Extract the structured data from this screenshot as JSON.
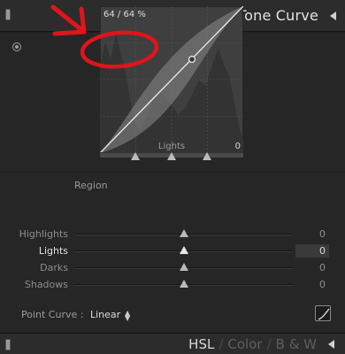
{
  "header": {
    "title": "Tone Curve"
  },
  "curve": {
    "readout": "64 / 64 %",
    "hover_region": "Lights",
    "edge_value": "0",
    "control_point": {
      "input_percent": 64,
      "output_percent": 64
    }
  },
  "region": {
    "heading": "Region",
    "sliders": [
      {
        "label": "Highlights",
        "value": "0",
        "level": 0.5
      },
      {
        "label": "Lights",
        "value": "0",
        "level": 0.5,
        "active": true
      },
      {
        "label": "Darks",
        "value": "0",
        "level": 0.5
      },
      {
        "label": "Shadows",
        "value": "0",
        "level": 0.5
      }
    ]
  },
  "point_curve": {
    "label": "Point Curve :",
    "value": "Linear"
  },
  "footer": {
    "tabs": [
      "HSL",
      "Color",
      "B & W"
    ],
    "active_tab": "HSL"
  },
  "colors": {
    "annotation_red": "#e0141a",
    "panel_bg": "#262626",
    "header_bg": "#2c2c2c"
  }
}
